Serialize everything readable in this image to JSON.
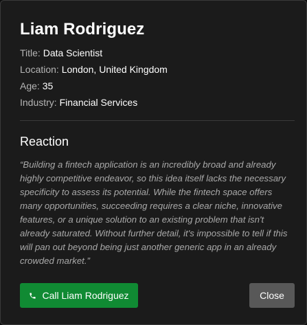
{
  "profile": {
    "name": "Liam Rodriguez",
    "fields": [
      {
        "label": "Title:",
        "value": "Data Scientist"
      },
      {
        "label": "Location:",
        "value": "London, United Kingdom"
      },
      {
        "label": "Age:",
        "value": "35"
      },
      {
        "label": "Industry:",
        "value": "Financial Services"
      }
    ]
  },
  "reaction": {
    "heading": "Reaction",
    "quote": "“Building a fintech application is an incredibly broad and already highly competitive endeavor, so this idea itself lacks the necessary specificity to assess its potential. While the fintech space offers many opportunities, succeeding requires a clear niche, innovative features, or a unique solution to an existing problem that isn't already saturated. Without further detail, it's impossible to tell if this will pan out beyond being just another generic app in an already crowded market.”"
  },
  "actions": {
    "call_label": "Call Liam Rodriguez",
    "call_icon": "phone-icon",
    "close_label": "Close"
  },
  "colors": {
    "call_button": "#108a33",
    "close_button": "#585858",
    "card_background": "#1b1b1b"
  }
}
